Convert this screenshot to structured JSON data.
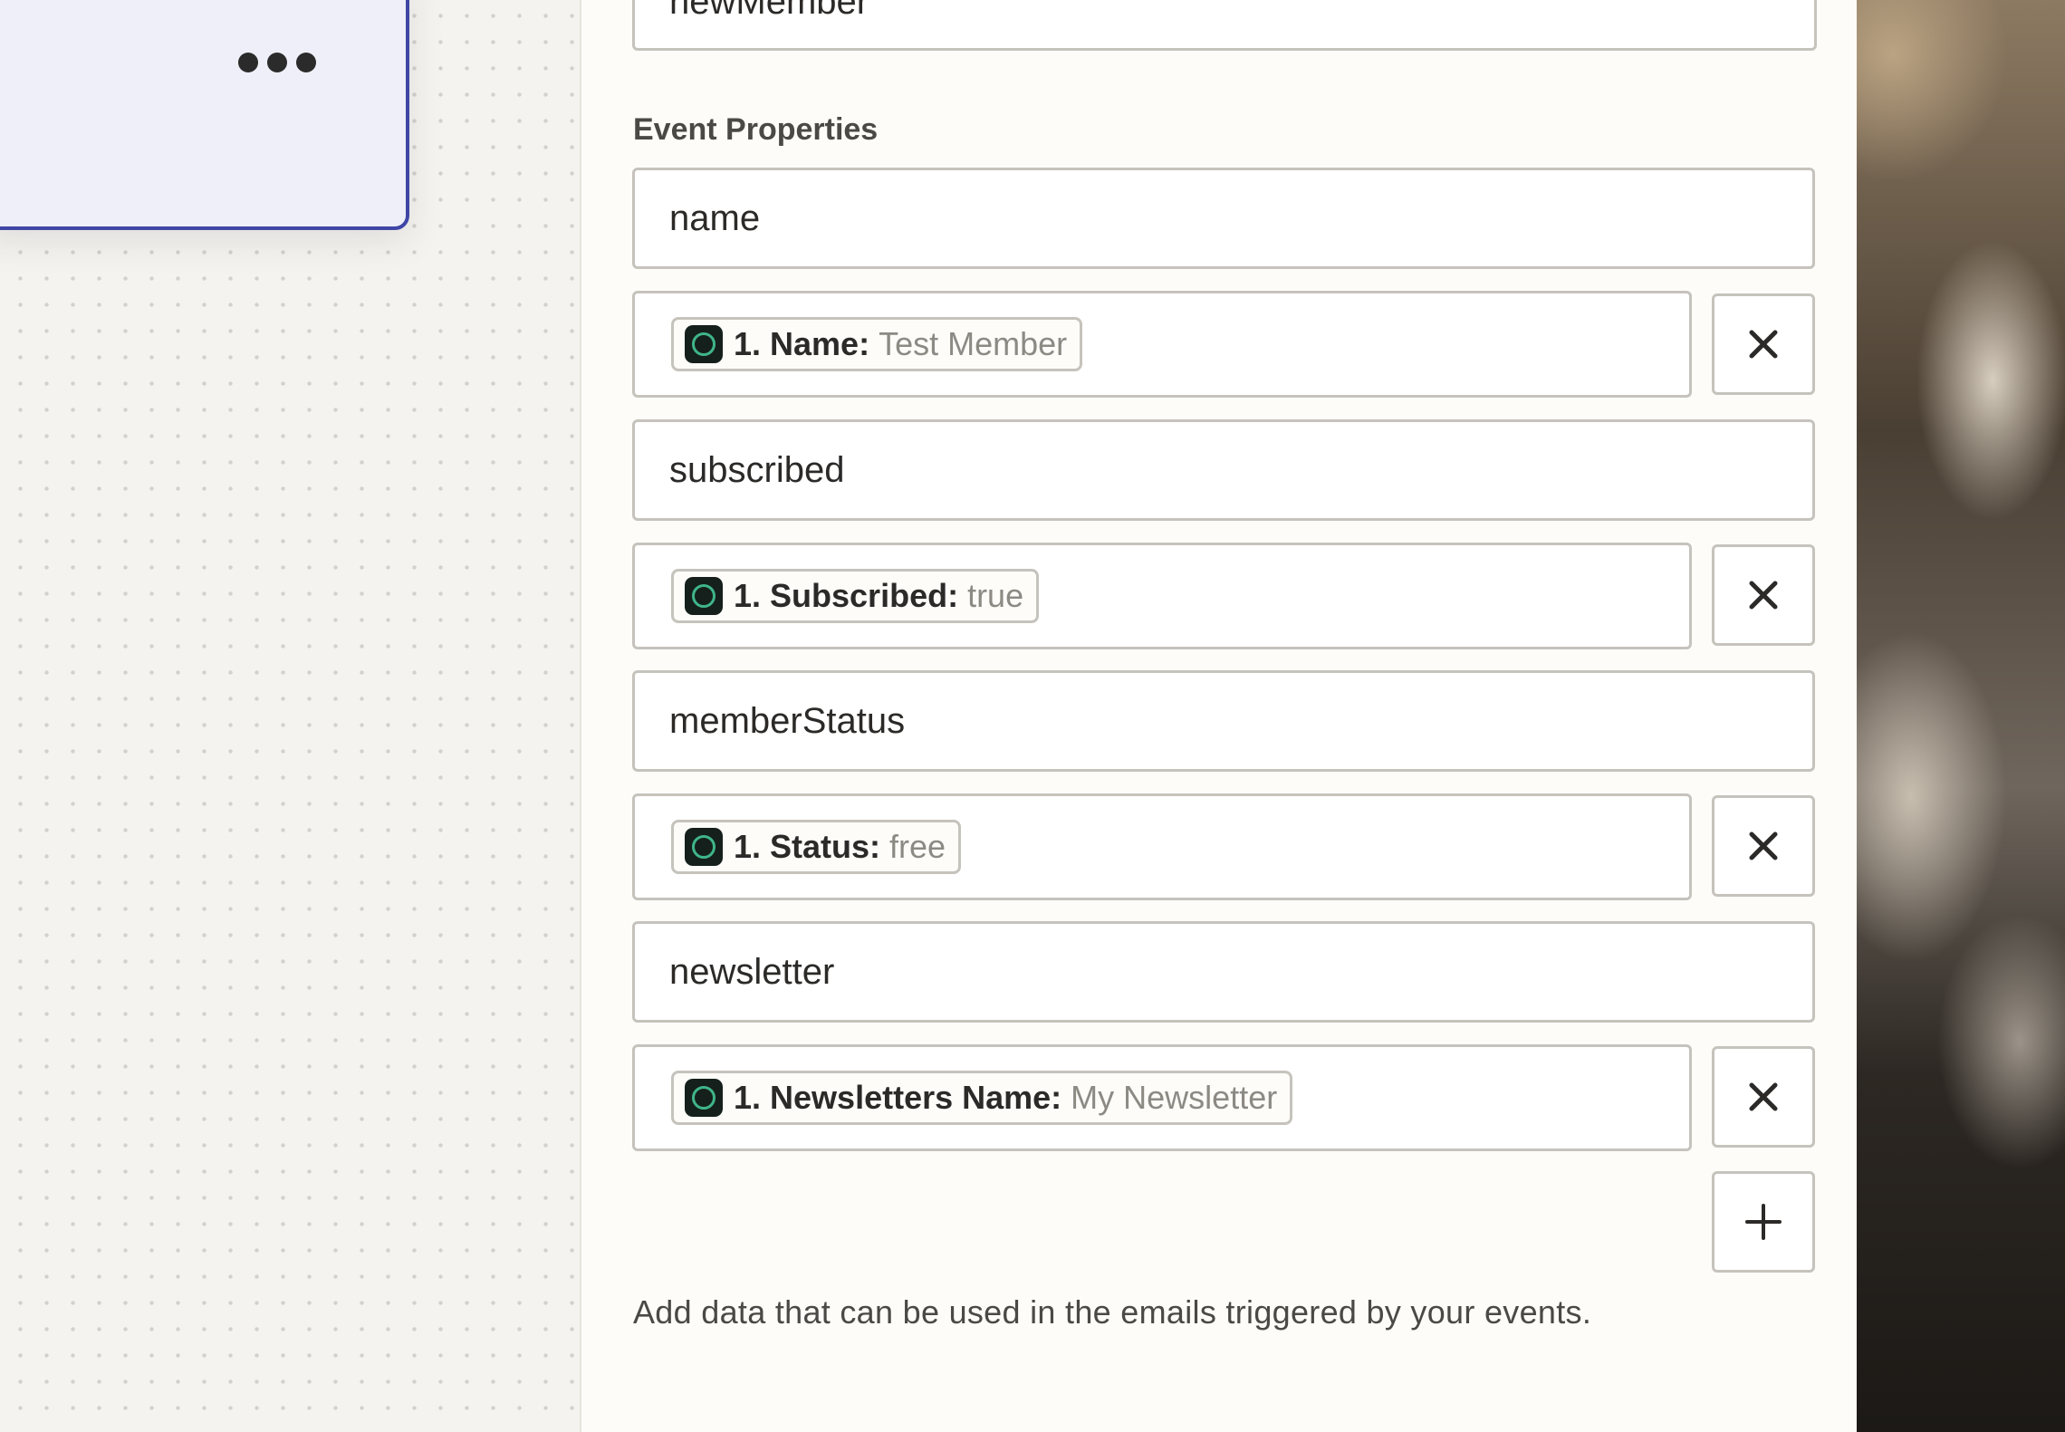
{
  "canvas": {
    "step_card": {
      "more_icon": "more-horizontal-icon"
    }
  },
  "panel": {
    "top_field_value": "newMember",
    "section_label": "Event Properties",
    "properties": [
      {
        "key": "name",
        "value_app_icon": "app-icon",
        "value_key": "1. Name:",
        "value_sample": "Test Member"
      },
      {
        "key": "subscribed",
        "value_app_icon": "app-icon",
        "value_key": "1. Subscribed:",
        "value_sample": "true"
      },
      {
        "key": "memberStatus",
        "value_app_icon": "app-icon",
        "value_key": "1. Status:",
        "value_sample": "free"
      },
      {
        "key": "newsletter",
        "value_app_icon": "app-icon",
        "value_key": "1. Newsletters Name:",
        "value_sample": "My Newsletter"
      }
    ],
    "remove_icon": "close-icon",
    "add_icon": "plus-icon",
    "help_text": "Add data that can be used in the emails triggered by your events."
  },
  "colors": {
    "card_border": "#3f46a6",
    "card_bg": "#efeff9",
    "app_icon_ring": "#3fb58a"
  }
}
